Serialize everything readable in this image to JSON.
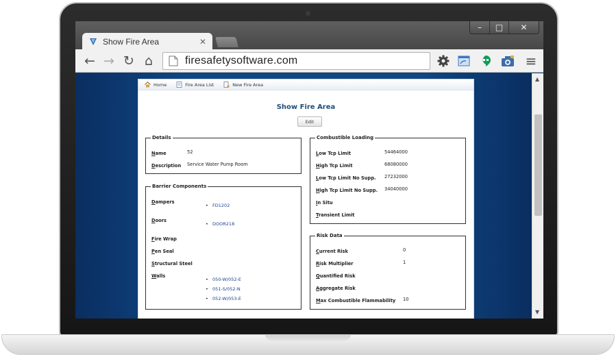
{
  "browser": {
    "tab_title": "Show Fire Area",
    "address": "firesafetysoftware.com",
    "window_controls": {
      "minimize": "–",
      "maximize": "□",
      "close": "✕"
    },
    "nav": {
      "back": "←",
      "forward": "→",
      "reload": "↻",
      "home": "⌂",
      "menu": "≡"
    }
  },
  "app": {
    "breadcrumbs": [
      "Home",
      "Fire Area List",
      "New Fire Area"
    ],
    "page_title": "Show Fire Area",
    "edit_label": "Edit",
    "details": {
      "legend": "Details",
      "name_label": "Name",
      "name_value": "52",
      "description_label": "Description",
      "description_value": "Service Water Pump Room"
    },
    "barrier": {
      "legend": "Barrier Components",
      "dampers_label": "Dampers",
      "dampers": [
        "FD1202"
      ],
      "doors_label": "Doors",
      "doors": [
        "DOOR218"
      ],
      "fire_wrap_label": "Fire Wrap",
      "pen_seal_label": "Pen Seal",
      "structural_steel_label": "Structural Steel",
      "walls_label": "Walls",
      "walls": [
        "050-W/052-E",
        "051-S/052-N",
        "052-W/053-E"
      ]
    },
    "combustible": {
      "legend": "Combustible Loading",
      "low_tcp_label": "Low Tcp Limit",
      "low_tcp_value": "54464000",
      "high_tcp_label": "High Tcp Limit",
      "high_tcp_value": "68080000",
      "low_tcp_ns_label": "Low Tcp Limit No Supp.",
      "low_tcp_ns_value": "27232000",
      "high_tcp_ns_label": "High Tcp Limit No Supp.",
      "high_tcp_ns_value": "34040000",
      "in_situ_label": "In Situ",
      "transient_label": "Transient Limit"
    },
    "risk": {
      "legend": "Risk Data",
      "current_label": "Current Risk",
      "current_value": "0",
      "multiplier_label": "Risk Multiplier",
      "multiplier_value": "1",
      "quantified_label": "Quantified Risk",
      "aggregate_label": "Aggregate Risk",
      "max_flam_label": "Max Combustible Flammability",
      "max_flam_value": "10"
    }
  },
  "colors": {
    "title_blue": "#1f4e79",
    "link_blue": "#1a3f8a",
    "background_navy": "#0f4785",
    "chrome_frame": "#474747"
  }
}
